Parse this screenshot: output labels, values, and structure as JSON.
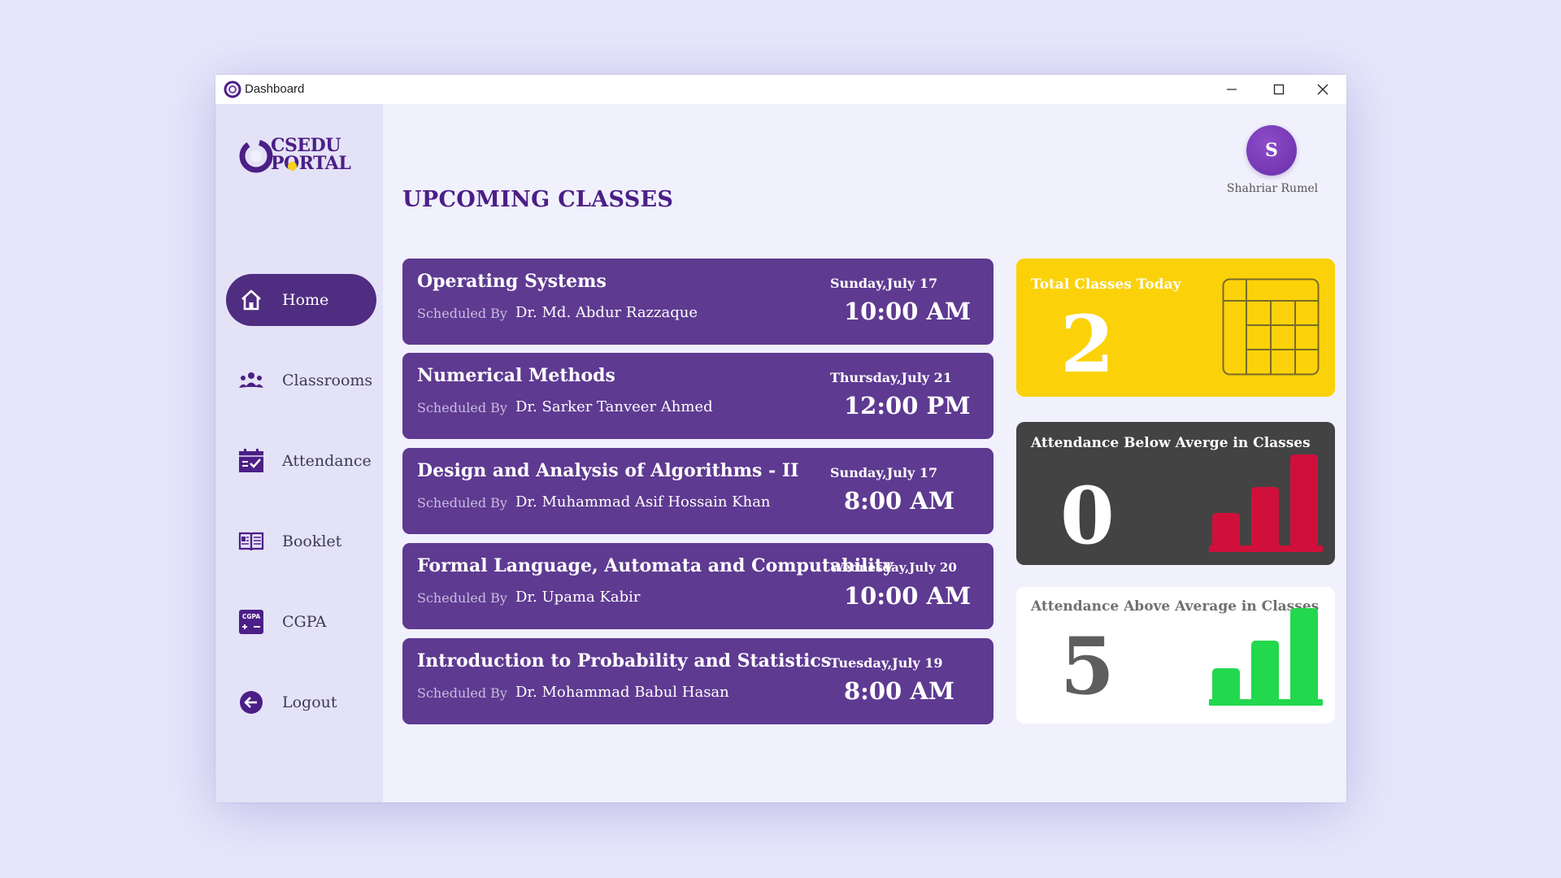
{
  "window": {
    "title": "Dashboard"
  },
  "brand": {
    "line1": "CSEDU",
    "line2": "PORTAL"
  },
  "user": {
    "initial": "S",
    "name": "Shahriar Rumel"
  },
  "nav": {
    "items": [
      {
        "label": "Home",
        "icon": "home-icon",
        "active": true
      },
      {
        "label": "Classrooms",
        "icon": "people-icon",
        "active": false
      },
      {
        "label": "Attendance",
        "icon": "calendar-check-icon",
        "active": false
      },
      {
        "label": "Booklet",
        "icon": "book-icon",
        "active": false
      },
      {
        "label": "CGPA",
        "icon": "calculator-icon",
        "active": false
      },
      {
        "label": "Logout",
        "icon": "logout-arrow-icon",
        "active": false
      }
    ]
  },
  "main": {
    "title": "UPCOMING CLASSES",
    "scheduled_by_label": "Scheduled By",
    "classes": [
      {
        "name": "Operating Systems",
        "teacher": "Dr. Md. Abdur Razzaque",
        "date": "Sunday,July 17",
        "time": "10:00 AM"
      },
      {
        "name": "Numerical Methods",
        "teacher": "Dr. Sarker Tanveer Ahmed",
        "date": "Thursday,July 21",
        "time": "12:00 PM"
      },
      {
        "name": "Design and Analysis of Algorithms - II",
        "teacher": "Dr. Muhammad Asif Hossain Khan",
        "date": "Sunday,July 17",
        "time": "8:00 AM"
      },
      {
        "name": "Formal Language, Automata and Computability",
        "teacher": "Dr. Upama Kabir",
        "date": "Wednesday,July 20",
        "time": "10:00 AM"
      },
      {
        "name": "Introduction to Probability and Statistics",
        "teacher": "Dr. Mohammad Babul Hasan",
        "date": "Tuesday,July 19",
        "time": "8:00 AM"
      }
    ]
  },
  "stats": {
    "total_today": {
      "label": "Total Classes Today",
      "value": "2",
      "color": "#fbd209",
      "icon": "grid-table-icon"
    },
    "below_avg": {
      "label": "Attendance Below Averge in Classes",
      "value": "0",
      "color": "#434343",
      "accent": "#d0103a",
      "icon": "bar-chart-icon"
    },
    "above_avg": {
      "label": "Attendance Above Average in Classes",
      "value": "5",
      "color": "#ffffff",
      "accent": "#22d84c",
      "icon": "bar-chart-icon"
    }
  },
  "colors": {
    "primary": "#5e3a91",
    "active_nav": "#4f2d80",
    "title": "#4b1f86",
    "background": "#f1f0fd"
  }
}
